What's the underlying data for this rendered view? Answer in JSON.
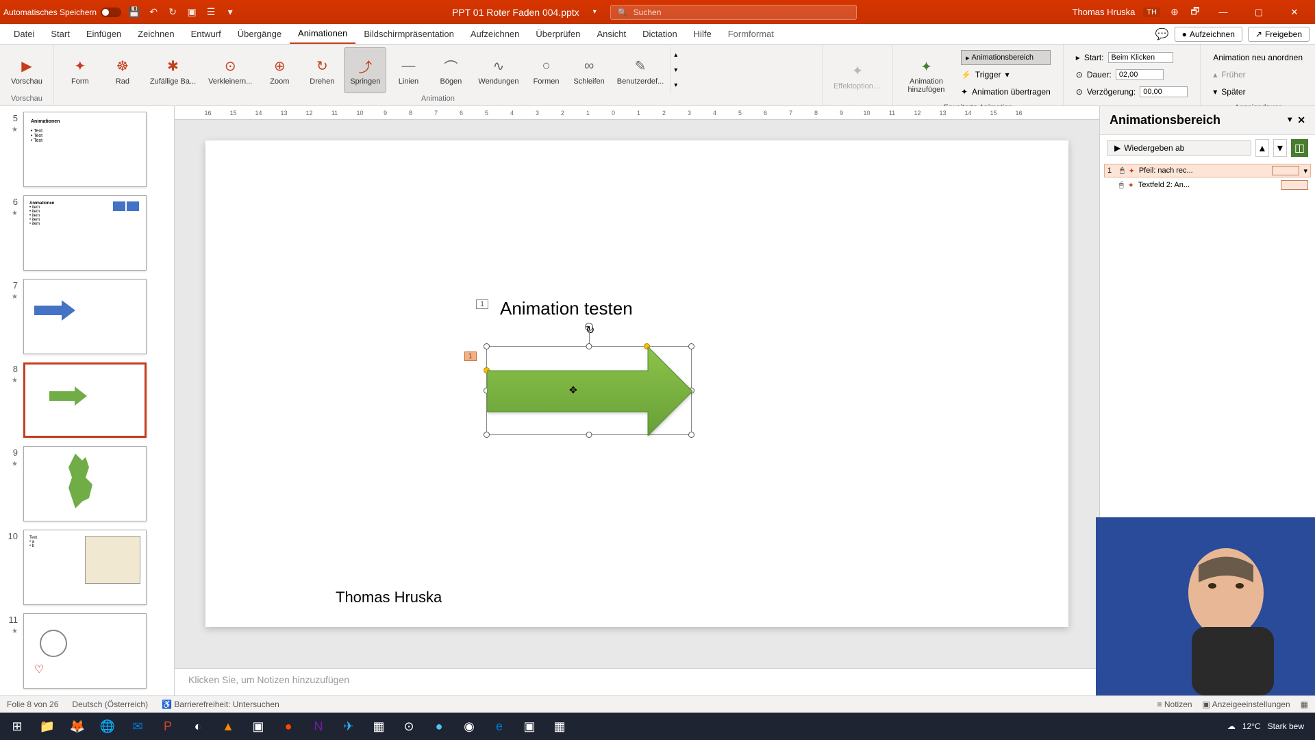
{
  "titlebar": {
    "autosave": "Automatisches Speichern",
    "filename": "PPT 01 Roter Faden 004.pptx",
    "search_placeholder": "Suchen",
    "username": "Thomas Hruska",
    "user_initials": "TH"
  },
  "tabs": {
    "items": [
      "Datei",
      "Start",
      "Einfügen",
      "Zeichnen",
      "Entwurf",
      "Übergänge",
      "Animationen",
      "Bildschirmpräsentation",
      "Aufzeichnen",
      "Überprüfen",
      "Ansicht",
      "Dictation",
      "Hilfe",
      "Formformat"
    ],
    "active_index": 6,
    "record": "Aufzeichnen",
    "share": "Freigeben"
  },
  "ribbon": {
    "preview": "Vorschau",
    "animations": [
      "Form",
      "Rad",
      "Zufällige Ba...",
      "Verkleinern...",
      "Zoom",
      "Drehen",
      "Springen",
      "Linien",
      "Bögen",
      "Wendungen",
      "Formen",
      "Schleifen",
      "Benutzerdef..."
    ],
    "selected_anim_index": 6,
    "group_animation": "Animation",
    "effect_options": "Effektoptionen",
    "add_animation": "Animation hinzufügen",
    "anim_pane": "Animationsbereich",
    "trigger": "Trigger",
    "transfer": "Animation übertragen",
    "extended": "Erweiterte Animation",
    "start_label": "Start:",
    "start_value": "Beim Klicken",
    "duration_label": "Dauer:",
    "duration_value": "02,00",
    "delay_label": "Verzögerung:",
    "delay_value": "00,00",
    "reorder": "Animation neu anordnen",
    "earlier": "Früher",
    "later": "Später",
    "timing": "Anzeigedauer"
  },
  "thumbs": [
    {
      "num": "5",
      "star": true
    },
    {
      "num": "6",
      "star": true
    },
    {
      "num": "7",
      "star": true
    },
    {
      "num": "8",
      "star": true,
      "selected": true
    },
    {
      "num": "9",
      "star": true
    },
    {
      "num": "10",
      "star": false
    },
    {
      "num": "11",
      "star": true
    }
  ],
  "slide": {
    "title": "Animation testen",
    "footer": "Thomas Hruska",
    "tag1": "1",
    "tag2": "1"
  },
  "anim_pane": {
    "title": "Animationsbereich",
    "play": "Wiedergeben ab",
    "items": [
      {
        "num": "1",
        "name": "Pfeil: nach rec...",
        "selected": true
      },
      {
        "num": "",
        "name": "Textfeld 2: An...",
        "selected": false
      }
    ]
  },
  "notes": {
    "placeholder": "Klicken Sie, um Notizen hinzuzufügen"
  },
  "statusbar": {
    "slide_info": "Folie 8 von 26",
    "language": "Deutsch (Österreich)",
    "accessibility": "Barrierefreiheit: Untersuchen",
    "notes": "Notizen",
    "display": "Anzeigeeinstellungen"
  },
  "taskbar": {
    "temp": "12°C",
    "weather": "Stark bew"
  },
  "ruler": [
    "16",
    "15",
    "14",
    "13",
    "12",
    "11",
    "10",
    "9",
    "8",
    "7",
    "6",
    "5",
    "4",
    "3",
    "2",
    "1",
    "0",
    "1",
    "2",
    "3",
    "4",
    "5",
    "6",
    "7",
    "8",
    "9",
    "10",
    "11",
    "12",
    "13",
    "14",
    "15",
    "16"
  ]
}
